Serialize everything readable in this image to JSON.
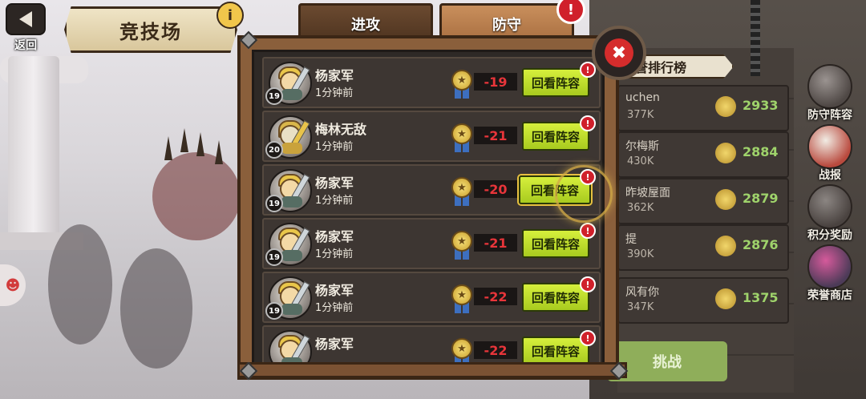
{
  "header": {
    "back_label": "返回",
    "title": "竞技场",
    "info_icon": "info-icon"
  },
  "tabs": [
    {
      "label": "进攻",
      "active": false
    },
    {
      "label": "防守",
      "active": true
    }
  ],
  "close_icon": "close-icon",
  "records": [
    {
      "name": "杨家军",
      "time": "1分钟前",
      "level": "19",
      "score": "-19",
      "button": "回看阵容"
    },
    {
      "name": "梅林无敌",
      "time": "1分钟前",
      "level": "20",
      "score": "-21",
      "button": "回看阵容"
    },
    {
      "name": "杨家军",
      "time": "1分钟前",
      "level": "19",
      "score": "-20",
      "button": "回看阵容"
    },
    {
      "name": "杨家军",
      "time": "1分钟前",
      "level": "19",
      "score": "-21",
      "button": "回看阵容"
    },
    {
      "name": "杨家军",
      "time": "1分钟前",
      "level": "19",
      "score": "-22",
      "button": "回看阵容"
    },
    {
      "name": "杨家军",
      "time": "",
      "level": "",
      "score": "-22",
      "button": "回看阵容"
    }
  ],
  "ranking": {
    "title": "誉排行榜",
    "rows": [
      {
        "name": "uchen",
        "power": "377K",
        "points": "2933"
      },
      {
        "name": "尔梅斯",
        "power": "430K",
        "points": "2884"
      },
      {
        "name": "昨坡屋面",
        "power": "362K",
        "points": "2879"
      },
      {
        "name": "提",
        "power": "390K",
        "points": "2876"
      },
      {
        "name": "风有你",
        "power": "347K",
        "points": "1375"
      }
    ],
    "challenge_label": "挑战"
  },
  "side_menu": [
    {
      "label": "防守阵容",
      "icon": "shield-icon"
    },
    {
      "label": "战报",
      "icon": "scroll-icon"
    },
    {
      "label": "积分奖励",
      "icon": "medal-icon"
    },
    {
      "label": "荣誉商店",
      "icon": "shop-icon"
    }
  ],
  "colors": {
    "frame": "#8a5f3b",
    "review_button": "#c4e02f",
    "score_text": "#e8353a",
    "alert": "#d0202b"
  }
}
